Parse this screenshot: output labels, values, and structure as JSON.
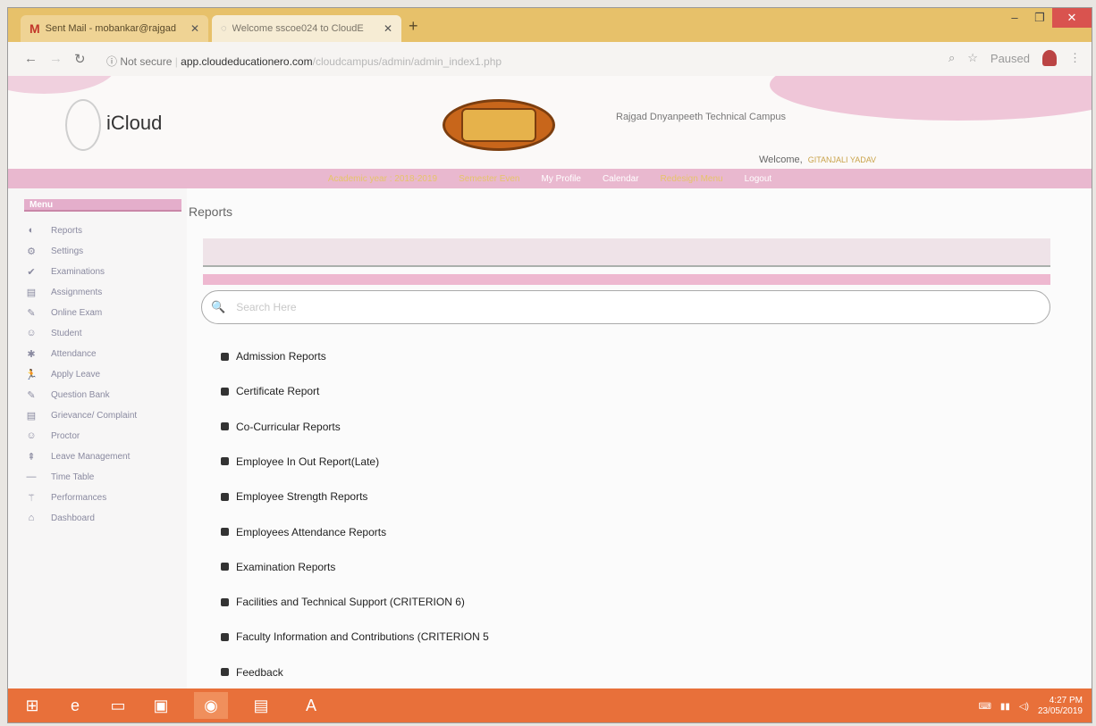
{
  "browser": {
    "tabs": [
      {
        "label": "Sent Mail - mobankar@rajgad",
        "icon": "gmail-icon"
      },
      {
        "label": "Welcome sscoe024 to CloudE",
        "icon": "page-icon"
      }
    ],
    "new_tab": "+",
    "address_host": "app.cloudeducationero.com",
    "address_path": "/cloudcampus/admin/admin_index1.php",
    "not_secure": "Not secure",
    "paused": "Paused"
  },
  "header": {
    "brand": "iCloud",
    "college": "Rajgad Dnyanpeeth Technical Campus",
    "welcome_label": "Welcome,",
    "welcome_user": "GITANJALI YADAV"
  },
  "menubar": {
    "academic_label": "Academic year",
    "academic_value": "2018-2019",
    "semester": "Semester Even",
    "my_profile": "My Profile",
    "calendar": "Calendar",
    "redesign": "Redesign Menu",
    "logout": "Logout"
  },
  "sidebar": {
    "header": "Menu",
    "items": [
      {
        "label": "Reports",
        "icon": "reports-icon",
        "glyph": "◐"
      },
      {
        "label": "Settings",
        "icon": "settings-icon",
        "glyph": "⚙"
      },
      {
        "label": "Examinations",
        "icon": "examinations-icon",
        "glyph": "✔"
      },
      {
        "label": "Assignments",
        "icon": "assignments-icon",
        "glyph": "▤"
      },
      {
        "label": "Online Exam",
        "icon": "online-exam-icon",
        "glyph": "✎"
      },
      {
        "label": "Student",
        "icon": "student-icon",
        "glyph": "☺"
      },
      {
        "label": "Attendance",
        "icon": "attendance-icon",
        "glyph": "✱"
      },
      {
        "label": "Apply Leave",
        "icon": "apply-leave-icon",
        "glyph": "🏃"
      },
      {
        "label": "Question Bank",
        "icon": "question-bank-icon",
        "glyph": "✎"
      },
      {
        "label": "Grievance/ Complaint",
        "icon": "grievance-icon",
        "glyph": "▤"
      },
      {
        "label": "Proctor",
        "icon": "proctor-icon",
        "glyph": "☺"
      },
      {
        "label": "Leave Management",
        "icon": "leave-management-icon",
        "glyph": "⇞"
      },
      {
        "label": "Time Table",
        "icon": "time-table-icon",
        "glyph": "—"
      },
      {
        "label": "Performances",
        "icon": "performances-icon",
        "glyph": "⚚"
      },
      {
        "label": "Dashboard",
        "icon": "dashboard-icon",
        "glyph": "⌂"
      }
    ]
  },
  "main": {
    "title": "Reports",
    "search_placeholder": "Search Here",
    "reports": [
      "Admission Reports",
      "Certificate Report",
      "Co-Curricular Reports",
      "Employee In Out Report(Late)",
      "Employee Strength Reports",
      "Employees Attendance Reports",
      "Examination Reports",
      "Facilities and Technical Support (CRITERION 6)",
      "Faculty Information and Contributions (CRITERION 5",
      "Feedback"
    ]
  },
  "taskbar": {
    "time": "4:27 PM",
    "date": "23/05/2019"
  },
  "colors": {
    "accent_pink": "#e9b8cf",
    "tab_yellow": "#e7c16a",
    "taskbar_orange": "#e8703a"
  }
}
